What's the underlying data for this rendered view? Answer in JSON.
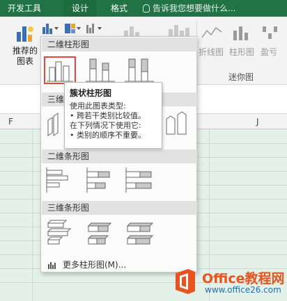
{
  "ribbon_tabs": [
    "开发工具",
    "设计",
    "格式"
  ],
  "tell_me": "告诉我您想要做什么...",
  "recommended_charts": "推荐的\n图表",
  "recommended_line1": "推荐的",
  "recommended_line2": "图表",
  "sparkline_labels": [
    "折线图",
    "柱形图",
    "盈亏"
  ],
  "sparkline_group": "迷你图",
  "columns": [
    "F",
    "J"
  ],
  "gallery": {
    "section_2d_column": "二维柱形图",
    "section_3d_column": "三维",
    "section_2d_bar": "二维条形图",
    "section_3d_bar": "三维条形图",
    "more_label": "更多柱形图(M)..."
  },
  "tooltip": {
    "title": "簇状柱形图",
    "line1": "使用此图表类型:",
    "line2": "• 跨若干类别比较值。",
    "line3": "在下列情况下使用它:",
    "line4": "• 类别的顺序不重要。"
  },
  "watermark": {
    "name": "Office教程网",
    "url": "www.office26.com"
  },
  "colors": {
    "ribbon_green": "#217346",
    "sheet_green": "#e3f1e8",
    "selection_red": "#e8453c",
    "watermark_orange": "#e8541e"
  }
}
